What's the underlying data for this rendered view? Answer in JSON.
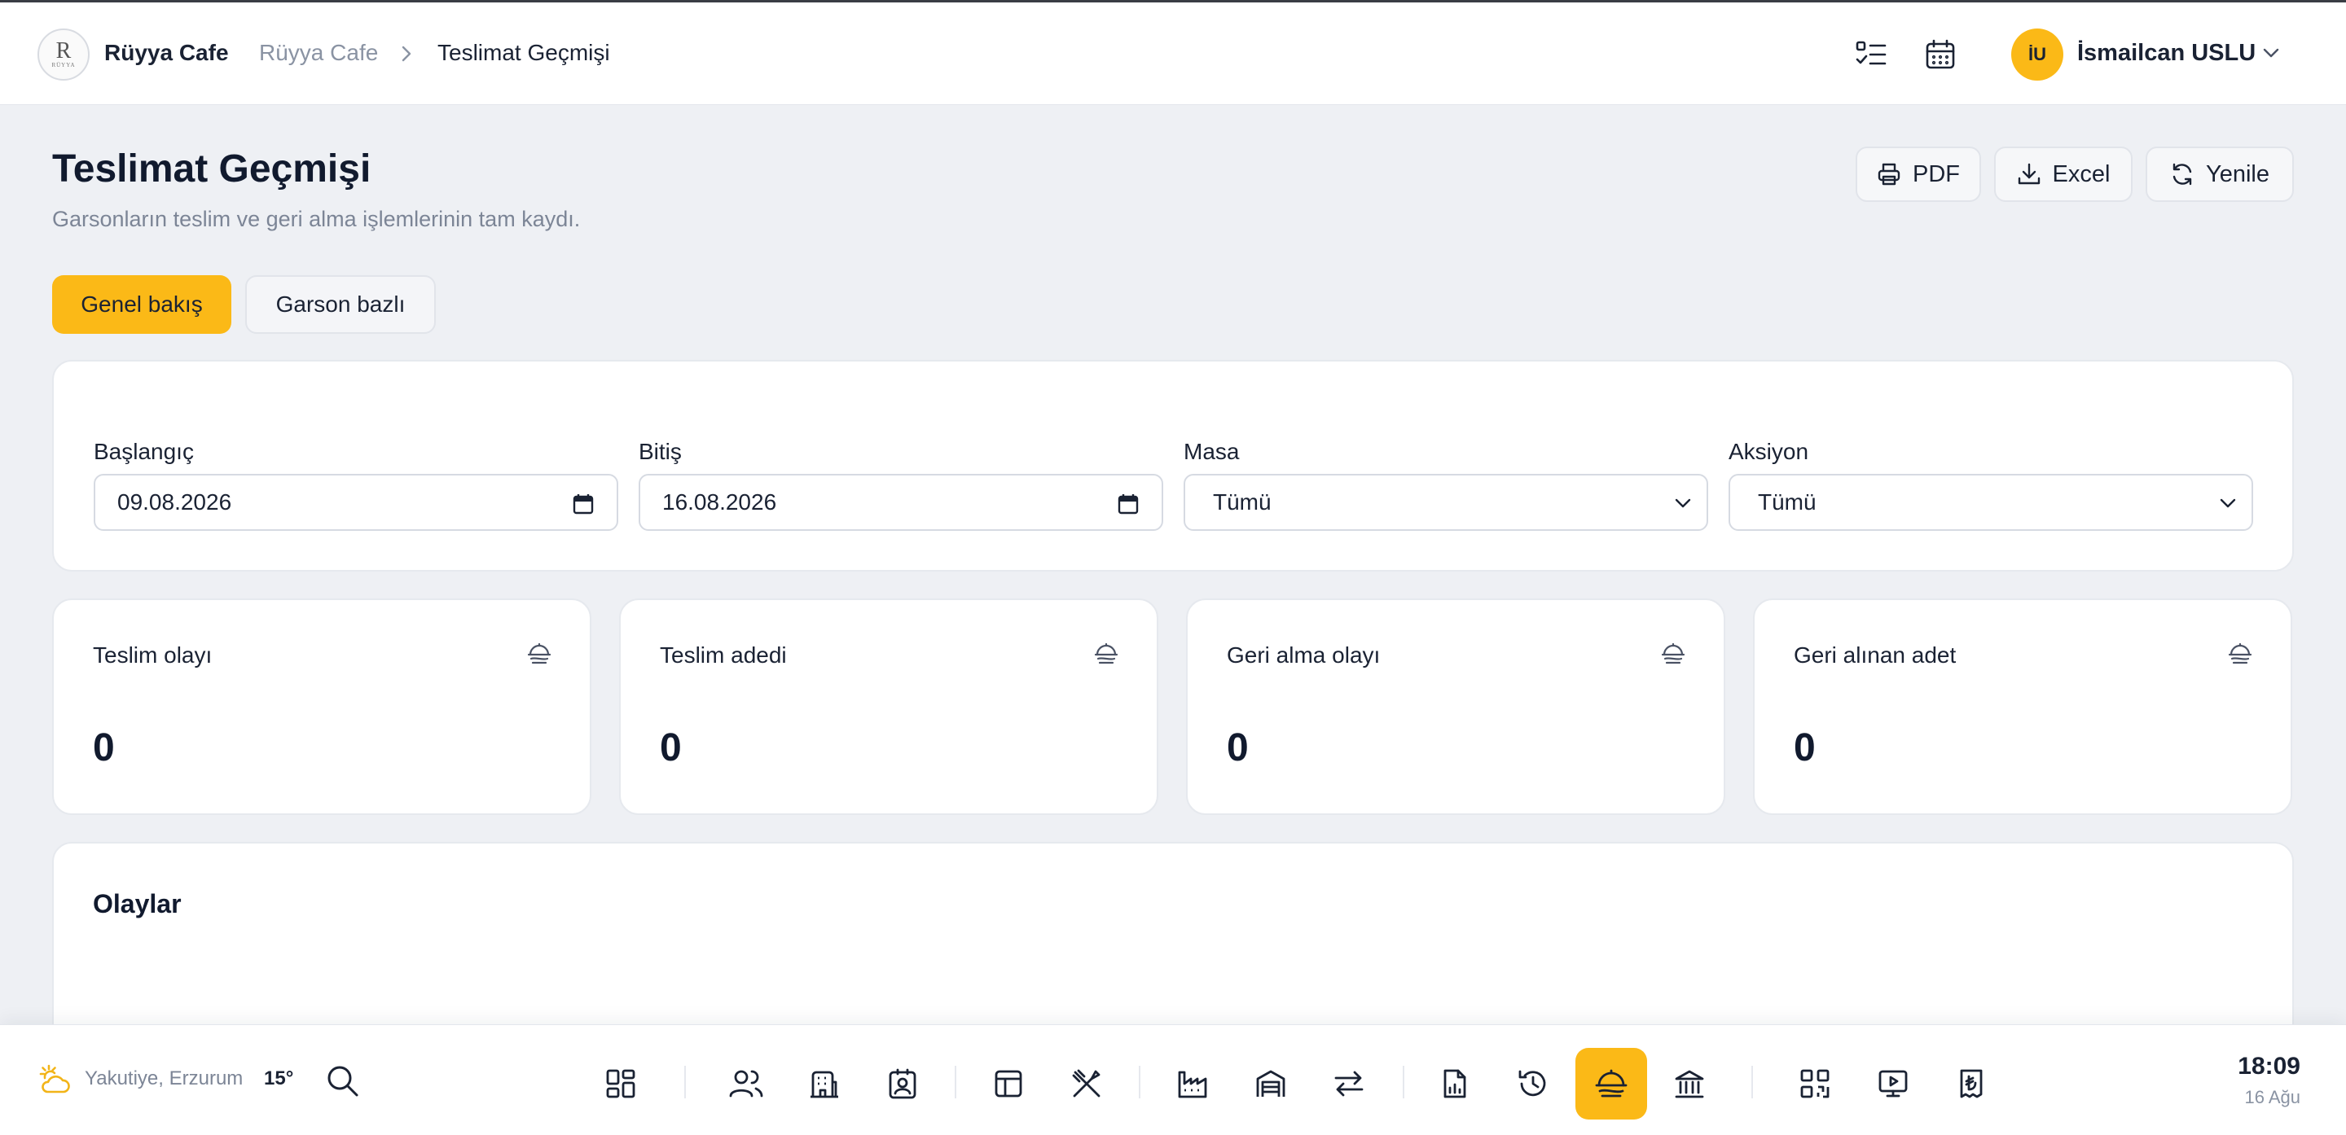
{
  "topbar": {
    "logo_monogram": "R",
    "logo_text": "RÜYYA",
    "brand": "Rüyya Cafe",
    "breadcrumb": [
      "Rüyya Cafe",
      "Teslimat Geçmişi"
    ],
    "user_initials": "İU",
    "user_name": "İsmailcan USLU"
  },
  "header": {
    "title": "Teslimat Geçmişi",
    "subtitle": "Garsonların teslim ve geri alma işlemlerinin tam kaydı.",
    "pdf_label": "PDF",
    "excel_label": "Excel",
    "refresh_label": "Yenile"
  },
  "tabs": [
    {
      "label": "Genel bakış",
      "active": true
    },
    {
      "label": "Garson bazlı",
      "active": false
    }
  ],
  "filters": {
    "start": {
      "label": "Başlangıç",
      "value": "09.08.2026"
    },
    "end": {
      "label": "Bitiş",
      "value": "16.08.2026"
    },
    "table": {
      "label": "Masa",
      "value": "Tümü"
    },
    "action": {
      "label": "Aksiyon",
      "value": "Tümü"
    }
  },
  "stats": [
    {
      "label": "Teslim olayı",
      "value": "0"
    },
    {
      "label": "Teslim adedi",
      "value": "0"
    },
    {
      "label": "Geri alma olayı",
      "value": "0"
    },
    {
      "label": "Geri alınan adet",
      "value": "0"
    }
  ],
  "events": {
    "title": "Olaylar"
  },
  "dock": {
    "location": "Yakutiye, Erzurum",
    "temperature": "15°",
    "time": "18:09",
    "date": "16 Ağu",
    "icons": [
      "dashboard-icon",
      "users-icon",
      "building-icon",
      "contact-card-icon",
      "layout-icon",
      "utensils-crossed-icon",
      "factory-icon",
      "warehouse-icon",
      "transfer-arrows-icon",
      "report-file-icon",
      "history-icon",
      "cloche-delivery-icon",
      "bank-icon",
      "qr-code-icon",
      "screen-play-icon",
      "lira-receipt-icon"
    ]
  },
  "colors": {
    "accent": "#fbb917",
    "text": "#1a2233",
    "muted": "#7c8596",
    "background": "#eef0f4"
  }
}
